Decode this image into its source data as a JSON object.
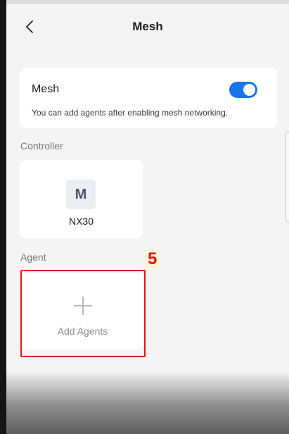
{
  "header": {
    "title": "Mesh"
  },
  "mesh_card": {
    "label": "Mesh",
    "toggle_on": true,
    "description": "You can add agents after enabling mesh networking."
  },
  "controller": {
    "section_label": "Controller",
    "device_name": "NX30",
    "logo_letter": "M"
  },
  "agent": {
    "section_label": "Agent",
    "add_label": "Add Agents"
  },
  "annotation": {
    "step": "5"
  },
  "colors": {
    "accent": "#1a73e8",
    "highlight": "#e01515"
  }
}
